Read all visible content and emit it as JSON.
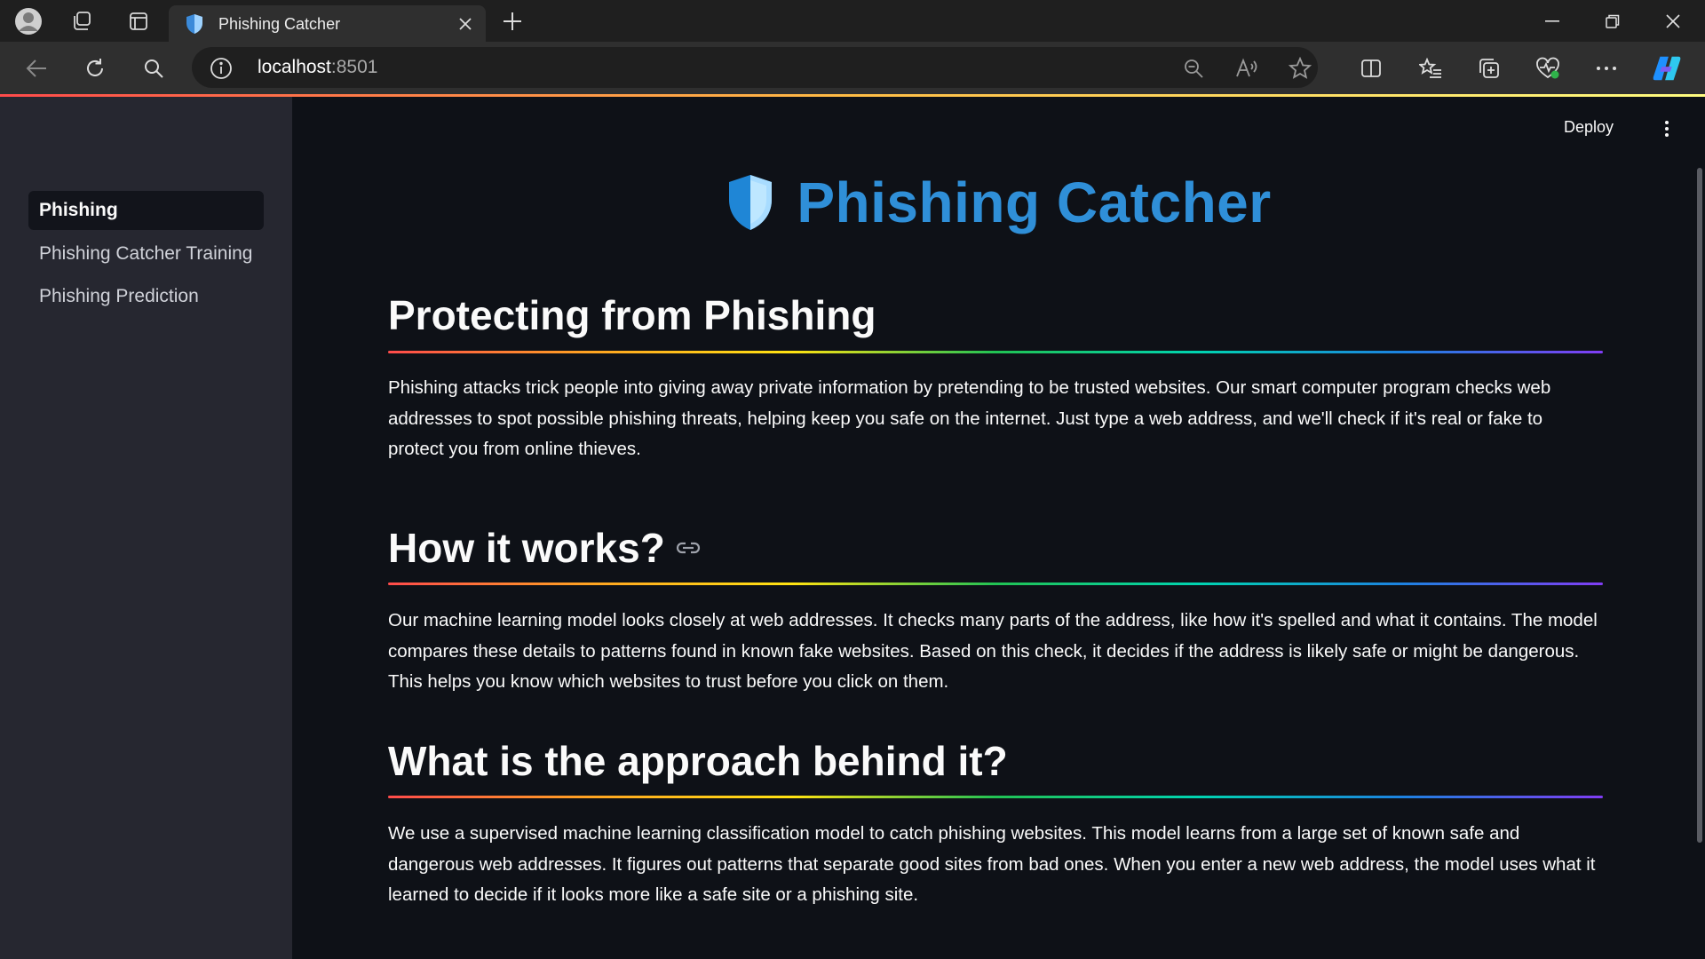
{
  "browser": {
    "tab_title": "Phishing Catcher",
    "url_host": "localhost",
    "url_port": ":8501"
  },
  "toolbar": {
    "deploy_label": "Deploy"
  },
  "sidebar": {
    "items": [
      {
        "label": "Phishing",
        "active": true
      },
      {
        "label": "Phishing Catcher Training",
        "active": false
      },
      {
        "label": "Phishing Prediction",
        "active": false
      }
    ]
  },
  "main": {
    "title": "Phishing Catcher",
    "sections": [
      {
        "heading": "Protecting from Phishing",
        "body": "Phishing attacks trick people into giving away private information by pretending to be trusted websites. Our smart computer program checks web addresses to spot possible phishing threats, helping keep you safe on the internet. Just type a web address, and we'll check if it's real or fake to protect you from online thieves."
      },
      {
        "heading": "How it works?",
        "body": "Our machine learning model looks closely at web addresses. It checks many parts of the address, like how it's spelled and what it contains. The model compares these details to patterns found in known fake websites. Based on this check, it decides if the address is likely safe or might be dangerous. This helps you know which websites to trust before you click on them."
      },
      {
        "heading": "What is the approach behind it?",
        "body": "We use a supervised machine learning classification model to catch phishing websites. This model learns from a large set of known safe and dangerous web addresses. It figures out patterns that separate good sites from bad ones. When you enter a new web address, the model uses what it learned to decide if it looks more like a safe site or a phishing site."
      }
    ]
  },
  "colors": {
    "accent_title": "#2f8fd8",
    "app_background": "#0e1117",
    "sidebar_background": "#262730"
  }
}
